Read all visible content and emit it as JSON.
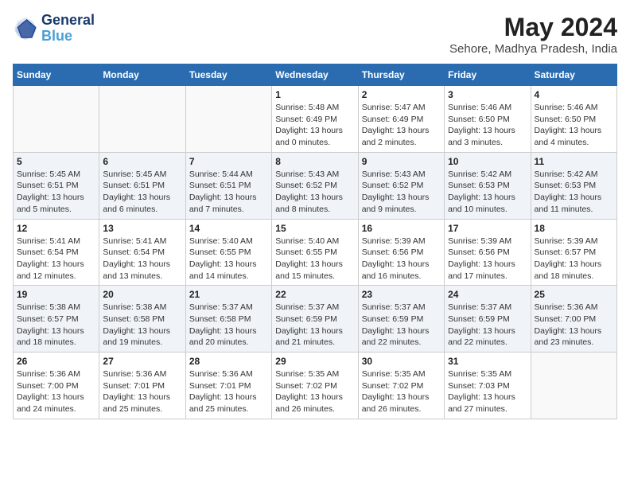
{
  "header": {
    "logo_text_general": "General",
    "logo_text_blue": "Blue",
    "month_year": "May 2024",
    "location": "Sehore, Madhya Pradesh, India"
  },
  "weekdays": [
    "Sunday",
    "Monday",
    "Tuesday",
    "Wednesday",
    "Thursday",
    "Friday",
    "Saturday"
  ],
  "weeks": [
    [
      {
        "day": "",
        "sunrise": "",
        "sunset": "",
        "daylight": ""
      },
      {
        "day": "",
        "sunrise": "",
        "sunset": "",
        "daylight": ""
      },
      {
        "day": "",
        "sunrise": "",
        "sunset": "",
        "daylight": ""
      },
      {
        "day": "1",
        "sunrise": "Sunrise: 5:48 AM",
        "sunset": "Sunset: 6:49 PM",
        "daylight": "Daylight: 13 hours and 0 minutes."
      },
      {
        "day": "2",
        "sunrise": "Sunrise: 5:47 AM",
        "sunset": "Sunset: 6:49 PM",
        "daylight": "Daylight: 13 hours and 2 minutes."
      },
      {
        "day": "3",
        "sunrise": "Sunrise: 5:46 AM",
        "sunset": "Sunset: 6:50 PM",
        "daylight": "Daylight: 13 hours and 3 minutes."
      },
      {
        "day": "4",
        "sunrise": "Sunrise: 5:46 AM",
        "sunset": "Sunset: 6:50 PM",
        "daylight": "Daylight: 13 hours and 4 minutes."
      }
    ],
    [
      {
        "day": "5",
        "sunrise": "Sunrise: 5:45 AM",
        "sunset": "Sunset: 6:51 PM",
        "daylight": "Daylight: 13 hours and 5 minutes."
      },
      {
        "day": "6",
        "sunrise": "Sunrise: 5:45 AM",
        "sunset": "Sunset: 6:51 PM",
        "daylight": "Daylight: 13 hours and 6 minutes."
      },
      {
        "day": "7",
        "sunrise": "Sunrise: 5:44 AM",
        "sunset": "Sunset: 6:51 PM",
        "daylight": "Daylight: 13 hours and 7 minutes."
      },
      {
        "day": "8",
        "sunrise": "Sunrise: 5:43 AM",
        "sunset": "Sunset: 6:52 PM",
        "daylight": "Daylight: 13 hours and 8 minutes."
      },
      {
        "day": "9",
        "sunrise": "Sunrise: 5:43 AM",
        "sunset": "Sunset: 6:52 PM",
        "daylight": "Daylight: 13 hours and 9 minutes."
      },
      {
        "day": "10",
        "sunrise": "Sunrise: 5:42 AM",
        "sunset": "Sunset: 6:53 PM",
        "daylight": "Daylight: 13 hours and 10 minutes."
      },
      {
        "day": "11",
        "sunrise": "Sunrise: 5:42 AM",
        "sunset": "Sunset: 6:53 PM",
        "daylight": "Daylight: 13 hours and 11 minutes."
      }
    ],
    [
      {
        "day": "12",
        "sunrise": "Sunrise: 5:41 AM",
        "sunset": "Sunset: 6:54 PM",
        "daylight": "Daylight: 13 hours and 12 minutes."
      },
      {
        "day": "13",
        "sunrise": "Sunrise: 5:41 AM",
        "sunset": "Sunset: 6:54 PM",
        "daylight": "Daylight: 13 hours and 13 minutes."
      },
      {
        "day": "14",
        "sunrise": "Sunrise: 5:40 AM",
        "sunset": "Sunset: 6:55 PM",
        "daylight": "Daylight: 13 hours and 14 minutes."
      },
      {
        "day": "15",
        "sunrise": "Sunrise: 5:40 AM",
        "sunset": "Sunset: 6:55 PM",
        "daylight": "Daylight: 13 hours and 15 minutes."
      },
      {
        "day": "16",
        "sunrise": "Sunrise: 5:39 AM",
        "sunset": "Sunset: 6:56 PM",
        "daylight": "Daylight: 13 hours and 16 minutes."
      },
      {
        "day": "17",
        "sunrise": "Sunrise: 5:39 AM",
        "sunset": "Sunset: 6:56 PM",
        "daylight": "Daylight: 13 hours and 17 minutes."
      },
      {
        "day": "18",
        "sunrise": "Sunrise: 5:39 AM",
        "sunset": "Sunset: 6:57 PM",
        "daylight": "Daylight: 13 hours and 18 minutes."
      }
    ],
    [
      {
        "day": "19",
        "sunrise": "Sunrise: 5:38 AM",
        "sunset": "Sunset: 6:57 PM",
        "daylight": "Daylight: 13 hours and 18 minutes."
      },
      {
        "day": "20",
        "sunrise": "Sunrise: 5:38 AM",
        "sunset": "Sunset: 6:58 PM",
        "daylight": "Daylight: 13 hours and 19 minutes."
      },
      {
        "day": "21",
        "sunrise": "Sunrise: 5:37 AM",
        "sunset": "Sunset: 6:58 PM",
        "daylight": "Daylight: 13 hours and 20 minutes."
      },
      {
        "day": "22",
        "sunrise": "Sunrise: 5:37 AM",
        "sunset": "Sunset: 6:59 PM",
        "daylight": "Daylight: 13 hours and 21 minutes."
      },
      {
        "day": "23",
        "sunrise": "Sunrise: 5:37 AM",
        "sunset": "Sunset: 6:59 PM",
        "daylight": "Daylight: 13 hours and 22 minutes."
      },
      {
        "day": "24",
        "sunrise": "Sunrise: 5:37 AM",
        "sunset": "Sunset: 6:59 PM",
        "daylight": "Daylight: 13 hours and 22 minutes."
      },
      {
        "day": "25",
        "sunrise": "Sunrise: 5:36 AM",
        "sunset": "Sunset: 7:00 PM",
        "daylight": "Daylight: 13 hours and 23 minutes."
      }
    ],
    [
      {
        "day": "26",
        "sunrise": "Sunrise: 5:36 AM",
        "sunset": "Sunset: 7:00 PM",
        "daylight": "Daylight: 13 hours and 24 minutes."
      },
      {
        "day": "27",
        "sunrise": "Sunrise: 5:36 AM",
        "sunset": "Sunset: 7:01 PM",
        "daylight": "Daylight: 13 hours and 25 minutes."
      },
      {
        "day": "28",
        "sunrise": "Sunrise: 5:36 AM",
        "sunset": "Sunset: 7:01 PM",
        "daylight": "Daylight: 13 hours and 25 minutes."
      },
      {
        "day": "29",
        "sunrise": "Sunrise: 5:35 AM",
        "sunset": "Sunset: 7:02 PM",
        "daylight": "Daylight: 13 hours and 26 minutes."
      },
      {
        "day": "30",
        "sunrise": "Sunrise: 5:35 AM",
        "sunset": "Sunset: 7:02 PM",
        "daylight": "Daylight: 13 hours and 26 minutes."
      },
      {
        "day": "31",
        "sunrise": "Sunrise: 5:35 AM",
        "sunset": "Sunset: 7:03 PM",
        "daylight": "Daylight: 13 hours and 27 minutes."
      },
      {
        "day": "",
        "sunrise": "",
        "sunset": "",
        "daylight": ""
      }
    ]
  ]
}
